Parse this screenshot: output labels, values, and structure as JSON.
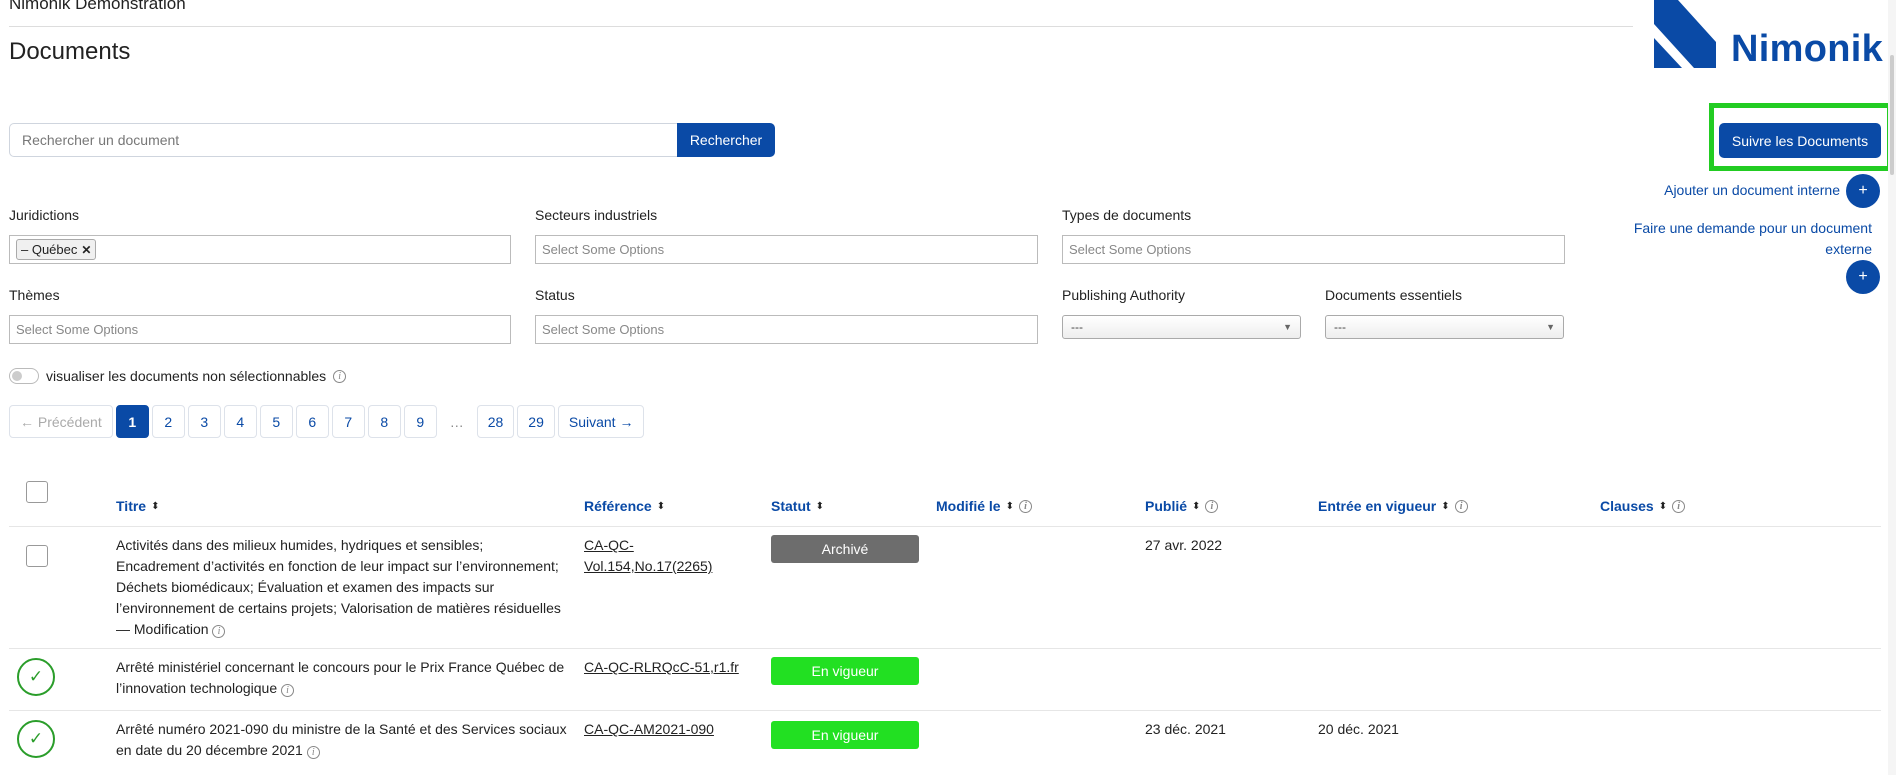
{
  "org_name": "Nimonik Demonstration",
  "page_title": "Documents",
  "logo": {
    "text": "Nimonik",
    "color": "#0a4aa6"
  },
  "search": {
    "placeholder": "Rechercher un document",
    "button": "Rechercher"
  },
  "sidebar": {
    "follow_button": "Suivre les Documents",
    "add_internal": "Ajouter un document interne",
    "request_external": "Faire une demande pour un document externe",
    "plus": "+"
  },
  "filters": {
    "jurisdictions": {
      "label": "Juridictions",
      "chip": "– Québec",
      "chip_remove": "✕"
    },
    "sectors": {
      "label": "Secteurs industriels",
      "placeholder": "Select Some Options"
    },
    "doc_types": {
      "label": "Types de documents",
      "placeholder": "Select Some Options"
    },
    "themes": {
      "label": "Thèmes",
      "placeholder": "Select Some Options"
    },
    "status": {
      "label": "Status",
      "placeholder": "Select Some Options"
    },
    "publishing_authority": {
      "label": "Publishing Authority",
      "value": "---"
    },
    "essential_docs": {
      "label": "Documents essentiels",
      "value": "---"
    }
  },
  "toggle": {
    "label": "visualiser les documents non sélectionnables",
    "on": false
  },
  "pagination": {
    "prev": "← Précédent",
    "pages": [
      "1",
      "2",
      "3",
      "4",
      "5",
      "6",
      "7",
      "8",
      "9"
    ],
    "ellipsis": "…",
    "last_pages": [
      "28",
      "29"
    ],
    "next": "Suivant →",
    "current": "1"
  },
  "table": {
    "headers": {
      "title": "Titre",
      "reference": "Référence",
      "status": "Statut",
      "modified": "Modifié le",
      "published": "Publié",
      "in_force": "Entrée en vigueur",
      "clauses": "Clauses"
    },
    "sort_glyph": "⬍",
    "rows": [
      {
        "title_lines": [
          "Activités dans des milieux humides, hydriques et sensibles;",
          "Encadrement d’activités en fonction de leur impact sur l’environnement;",
          "Déchets biomédicaux; Évaluation et examen des impacts sur",
          "l’environnement de certains projets; Valorisation de matières résiduelles",
          "— Modification"
        ],
        "reference_lines": [
          "CA-QC-",
          "Vol.154,No.17(2265)"
        ],
        "status": "Archivé",
        "status_color": "#6d6d6d",
        "modified": "",
        "published": "27 avr. 2022",
        "in_force": "",
        "selected": false
      },
      {
        "title_lines": [
          "Arrêté ministériel concernant le concours pour le Prix France Québec de",
          "l’innovation technologique"
        ],
        "reference_lines": [
          "CA-QC-RLRQcC-51,r1.fr"
        ],
        "status": "En vigueur",
        "status_color": "#22e022",
        "modified": "",
        "published": "",
        "in_force": "",
        "selected": true
      },
      {
        "title_lines": [
          "Arrêté numéro 2021-090 du ministre de la Santé et des Services sociaux",
          "en date du 20 décembre 2021"
        ],
        "reference_lines": [
          "CA-QC-AM2021-090"
        ],
        "status": "En vigueur",
        "status_color": "#22e022",
        "modified": "",
        "published": "23 déc. 2021",
        "in_force": "20 déc. 2021",
        "selected": true
      }
    ]
  }
}
